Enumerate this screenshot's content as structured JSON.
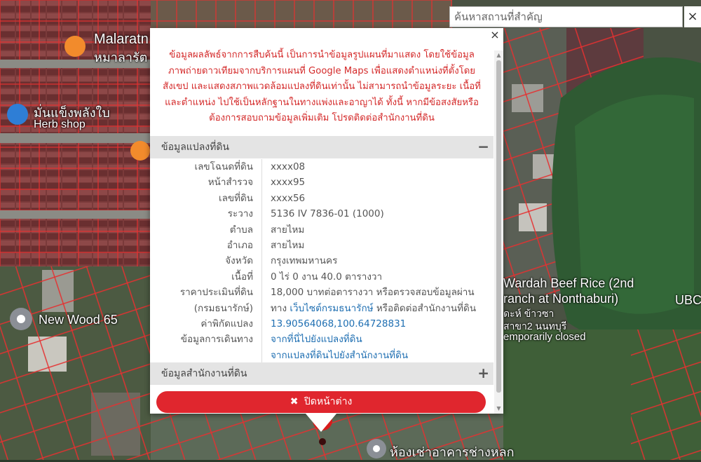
{
  "search": {
    "placeholder": "ค้นหาสถานที่สำคัญ",
    "clear_label": "×"
  },
  "map_labels": {
    "malaratn_1": "Malaratn",
    "malaratn_2": "หมาลารัต",
    "herb_thai": "มั่นแข็งพลังใบ",
    "herb_shop": "Herb shop",
    "new_wood": "New Wood 65",
    "wardah_1": "Wardah Beef Rice (2nd",
    "wardah_2": "ranch at Nonthaburi)",
    "wardah_3": "ดะห์ ข้าวซา",
    "wardah_4": "สาขา2 นนทบุรี",
    "wardah_5": "emporarily closed",
    "ub": "UBC",
    "bottom_place": "ห้องเช่าอาคารช่างหลก"
  },
  "popup": {
    "close_label": "×",
    "disclaimer": "ข้อมูลผลลัพธ์จากการสืบค้นนี้ เป็นการนำข้อมูลรูปแผนที่มาแสดง โดยใช้ข้อมูลภาพถ่ายดาวเทียมจากบริการแผนที่ Google Maps เพื่อแสดงตำแหน่งที่ตั้งโดยสังเขป และแสดงสภาพแวดล้อมแปลงที่ดินเท่านั้น ไม่สามารถนำข้อมูลระยะ เนื้อที่ และตำแหน่ง ไปใช้เป็นหลักฐานในทางแพ่งและอาญาได้ ทั้งนี้ หากมีข้อสงสัยหรือต้องการสอบถามข้อมูลเพิ่มเติม โปรดติดต่อสำนักงานที่ดิน",
    "parcel_section": {
      "title": "ข้อมูลแปลงที่ดิน",
      "toggle": "−"
    },
    "rows": [
      {
        "label": "เลขโฉนดที่ดิน",
        "value": "xxxx08"
      },
      {
        "label": "หน้าสำรวจ",
        "value": "xxxx95"
      },
      {
        "label": "เลขที่ดิน",
        "value": "xxxx56"
      },
      {
        "label": "ระวาง",
        "value": "5136 IV 7836-01 (1000)"
      },
      {
        "label": "ตำบล",
        "value": "สายไหม"
      },
      {
        "label": "อำเภอ",
        "value": "สายไหม"
      },
      {
        "label": "จังหวัด",
        "value": "กรุงเทพมหานคร"
      },
      {
        "label": "เนื้อที่",
        "value": "0 ไร่ 0 งาน 40.0 ตารางวา"
      }
    ],
    "price": {
      "label_1": "ราคาประเมินที่ดิน",
      "label_2": "(กรมธนารักษ์)",
      "value_1": "18,000 บาทต่อตารางวา หรือตรวจสอบข้อมูลผ่าน",
      "value_2a": "ทาง",
      "value_2_link": "เว็บไซต์กรมธนารักษ์",
      "value_2b": "หรือติดต่อสำนักงานที่ดิน"
    },
    "coords": {
      "label": "ค่าพิกัดแปลง",
      "value": "13.90564068,100.64728831"
    },
    "travel": {
      "label": "ข้อมูลการเดินทาง",
      "link_1": "จากที่นี่ไปยังแปลงที่ดิน",
      "link_2": "จากแปลงที่ดินไปยังสำนักงานที่ดิน"
    },
    "office_section": {
      "title": "ข้อมูลสำนักงานที่ดิน",
      "toggle": "+"
    },
    "close_button": {
      "icon": "✖",
      "label": "ปิดหน้าต่าง"
    }
  },
  "colors": {
    "accent_red": "#e0262e",
    "disclaimer_red": "#d42a2a",
    "link_blue": "#1f6fb2",
    "parcel_line": "#e53030"
  }
}
